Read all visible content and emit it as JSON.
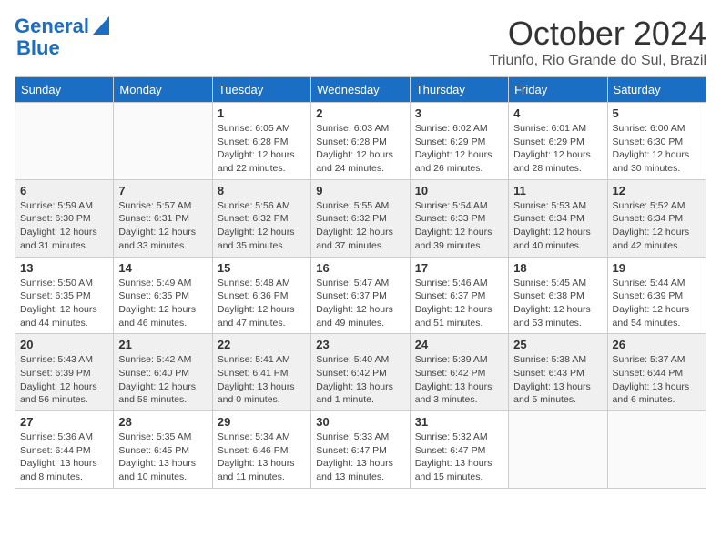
{
  "header": {
    "logo_line1": "General",
    "logo_line2": "Blue",
    "month": "October 2024",
    "location": "Triunfo, Rio Grande do Sul, Brazil"
  },
  "weekdays": [
    "Sunday",
    "Monday",
    "Tuesday",
    "Wednesday",
    "Thursday",
    "Friday",
    "Saturday"
  ],
  "weeks": [
    [
      {
        "day": "",
        "info": ""
      },
      {
        "day": "",
        "info": ""
      },
      {
        "day": "1",
        "info": "Sunrise: 6:05 AM\nSunset: 6:28 PM\nDaylight: 12 hours and 22 minutes."
      },
      {
        "day": "2",
        "info": "Sunrise: 6:03 AM\nSunset: 6:28 PM\nDaylight: 12 hours and 24 minutes."
      },
      {
        "day": "3",
        "info": "Sunrise: 6:02 AM\nSunset: 6:29 PM\nDaylight: 12 hours and 26 minutes."
      },
      {
        "day": "4",
        "info": "Sunrise: 6:01 AM\nSunset: 6:29 PM\nDaylight: 12 hours and 28 minutes."
      },
      {
        "day": "5",
        "info": "Sunrise: 6:00 AM\nSunset: 6:30 PM\nDaylight: 12 hours and 30 minutes."
      }
    ],
    [
      {
        "day": "6",
        "info": "Sunrise: 5:59 AM\nSunset: 6:30 PM\nDaylight: 12 hours and 31 minutes."
      },
      {
        "day": "7",
        "info": "Sunrise: 5:57 AM\nSunset: 6:31 PM\nDaylight: 12 hours and 33 minutes."
      },
      {
        "day": "8",
        "info": "Sunrise: 5:56 AM\nSunset: 6:32 PM\nDaylight: 12 hours and 35 minutes."
      },
      {
        "day": "9",
        "info": "Sunrise: 5:55 AM\nSunset: 6:32 PM\nDaylight: 12 hours and 37 minutes."
      },
      {
        "day": "10",
        "info": "Sunrise: 5:54 AM\nSunset: 6:33 PM\nDaylight: 12 hours and 39 minutes."
      },
      {
        "day": "11",
        "info": "Sunrise: 5:53 AM\nSunset: 6:34 PM\nDaylight: 12 hours and 40 minutes."
      },
      {
        "day": "12",
        "info": "Sunrise: 5:52 AM\nSunset: 6:34 PM\nDaylight: 12 hours and 42 minutes."
      }
    ],
    [
      {
        "day": "13",
        "info": "Sunrise: 5:50 AM\nSunset: 6:35 PM\nDaylight: 12 hours and 44 minutes."
      },
      {
        "day": "14",
        "info": "Sunrise: 5:49 AM\nSunset: 6:35 PM\nDaylight: 12 hours and 46 minutes."
      },
      {
        "day": "15",
        "info": "Sunrise: 5:48 AM\nSunset: 6:36 PM\nDaylight: 12 hours and 47 minutes."
      },
      {
        "day": "16",
        "info": "Sunrise: 5:47 AM\nSunset: 6:37 PM\nDaylight: 12 hours and 49 minutes."
      },
      {
        "day": "17",
        "info": "Sunrise: 5:46 AM\nSunset: 6:37 PM\nDaylight: 12 hours and 51 minutes."
      },
      {
        "day": "18",
        "info": "Sunrise: 5:45 AM\nSunset: 6:38 PM\nDaylight: 12 hours and 53 minutes."
      },
      {
        "day": "19",
        "info": "Sunrise: 5:44 AM\nSunset: 6:39 PM\nDaylight: 12 hours and 54 minutes."
      }
    ],
    [
      {
        "day": "20",
        "info": "Sunrise: 5:43 AM\nSunset: 6:39 PM\nDaylight: 12 hours and 56 minutes."
      },
      {
        "day": "21",
        "info": "Sunrise: 5:42 AM\nSunset: 6:40 PM\nDaylight: 12 hours and 58 minutes."
      },
      {
        "day": "22",
        "info": "Sunrise: 5:41 AM\nSunset: 6:41 PM\nDaylight: 13 hours and 0 minutes."
      },
      {
        "day": "23",
        "info": "Sunrise: 5:40 AM\nSunset: 6:42 PM\nDaylight: 13 hours and 1 minute."
      },
      {
        "day": "24",
        "info": "Sunrise: 5:39 AM\nSunset: 6:42 PM\nDaylight: 13 hours and 3 minutes."
      },
      {
        "day": "25",
        "info": "Sunrise: 5:38 AM\nSunset: 6:43 PM\nDaylight: 13 hours and 5 minutes."
      },
      {
        "day": "26",
        "info": "Sunrise: 5:37 AM\nSunset: 6:44 PM\nDaylight: 13 hours and 6 minutes."
      }
    ],
    [
      {
        "day": "27",
        "info": "Sunrise: 5:36 AM\nSunset: 6:44 PM\nDaylight: 13 hours and 8 minutes."
      },
      {
        "day": "28",
        "info": "Sunrise: 5:35 AM\nSunset: 6:45 PM\nDaylight: 13 hours and 10 minutes."
      },
      {
        "day": "29",
        "info": "Sunrise: 5:34 AM\nSunset: 6:46 PM\nDaylight: 13 hours and 11 minutes."
      },
      {
        "day": "30",
        "info": "Sunrise: 5:33 AM\nSunset: 6:47 PM\nDaylight: 13 hours and 13 minutes."
      },
      {
        "day": "31",
        "info": "Sunrise: 5:32 AM\nSunset: 6:47 PM\nDaylight: 13 hours and 15 minutes."
      },
      {
        "day": "",
        "info": ""
      },
      {
        "day": "",
        "info": ""
      }
    ]
  ]
}
